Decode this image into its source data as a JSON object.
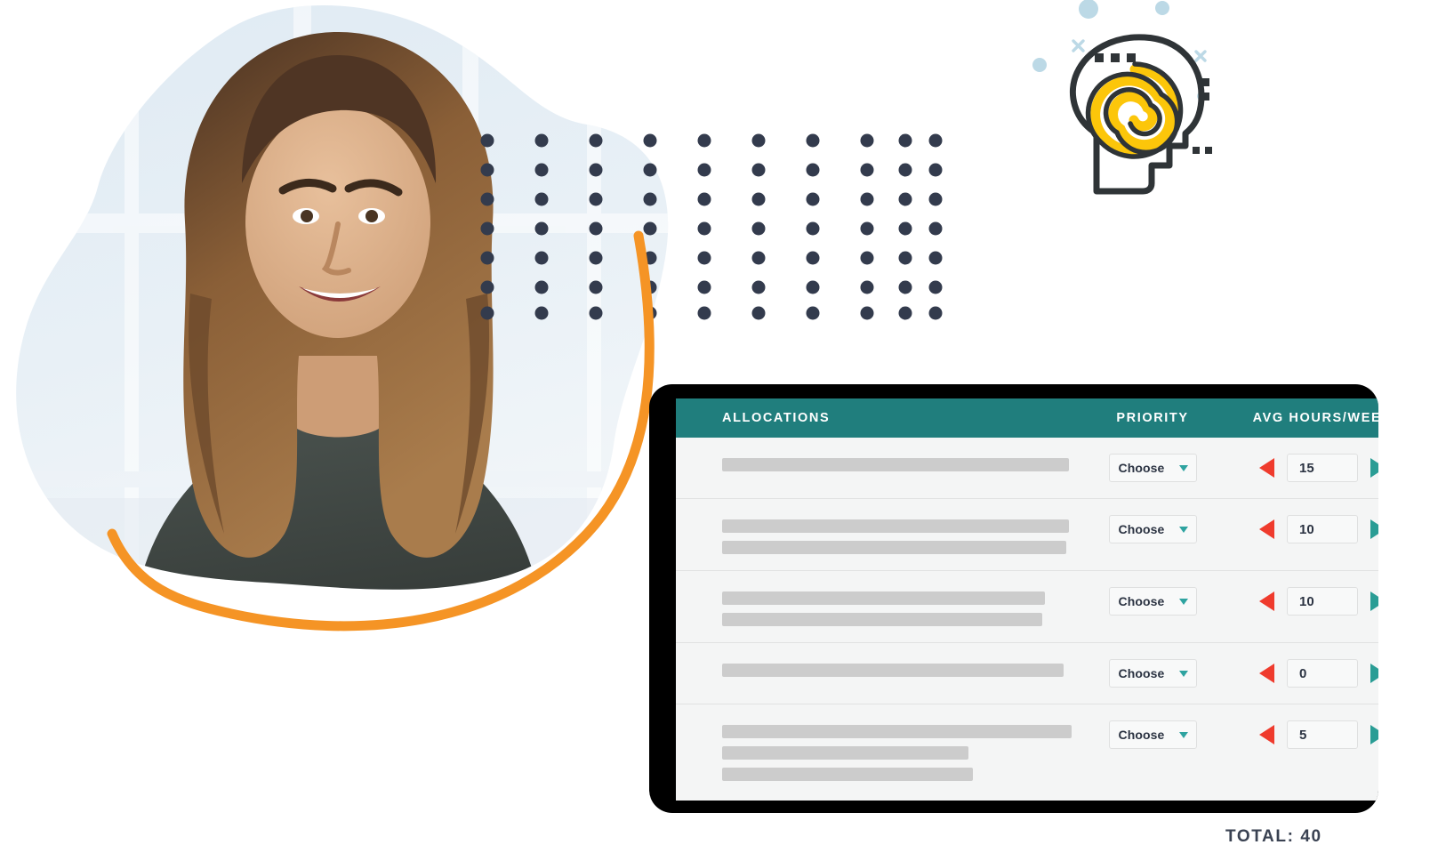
{
  "table": {
    "headers": {
      "allocations": "ALLOCATIONS",
      "priority": "PRIORITY",
      "hours": "AVG HOURS/WEEK"
    },
    "rows": [
      {
        "bars": [
          390
        ],
        "priority": "Choose",
        "hours": "15"
      },
      {
        "bars": [
          390,
          387
        ],
        "priority": "Choose",
        "hours": "10"
      },
      {
        "bars": [
          363,
          360
        ],
        "priority": "Choose",
        "hours": "10"
      },
      {
        "bars": [
          384
        ],
        "priority": "Choose",
        "hours": "0"
      },
      {
        "bars": [
          393,
          277,
          282
        ],
        "priority": "Choose",
        "hours": "5"
      }
    ],
    "total_label": "TOTAL: 40"
  },
  "icons": {
    "caret_down": "chevron-down-icon",
    "arrow_left": "decrement-arrow-icon",
    "arrow_right": "increment-arrow-icon",
    "brain": "brain-head-icon",
    "dots": "dot-grid-pattern",
    "swoosh": "orange-swoosh-icon"
  },
  "colors": {
    "header_teal": "#207e7d",
    "accent_teal": "#2a9d95",
    "accent_red": "#ef3b2d",
    "accent_orange": "#f59425",
    "accent_yellow": "#fcc60a",
    "navy": "#333b4d",
    "light_blue": "#bcd9e6",
    "skeleton_gray": "#cccccc"
  }
}
